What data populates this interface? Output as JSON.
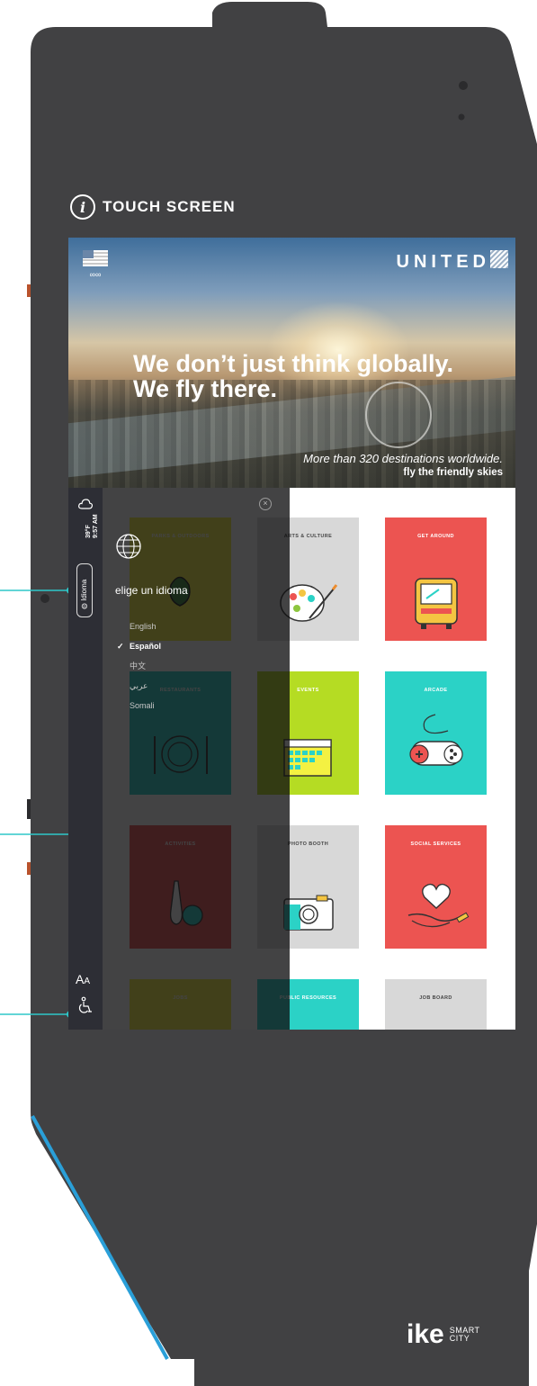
{
  "header": {
    "title": "TOUCH SCREEN",
    "info_icon": "info-icon"
  },
  "ad": {
    "brand": "UNITED",
    "headline_line1": "We don’t just think globally.",
    "headline_line2": "We fly there.",
    "tagline": "More than 320 destinations worldwide.",
    "sub_tagline": "fly the friendly skies"
  },
  "sidebar": {
    "temperature": "39°F",
    "time": "9:57 AM",
    "language_button": "Idioma",
    "text_size_label": "A",
    "text_size_label_small": "A"
  },
  "overlay": {
    "title": "elige un idioma",
    "languages": [
      {
        "label": "English",
        "selected": false
      },
      {
        "label": "Español",
        "selected": true
      },
      {
        "label": "中文",
        "selected": false
      },
      {
        "label": "عربي",
        "selected": false
      },
      {
        "label": "Somali",
        "selected": false
      }
    ],
    "check_mark": "✓",
    "close_icon": "close-icon"
  },
  "tiles": [
    {
      "label": "PARKS & OUTDOORS",
      "color": "#f4f142",
      "dimmed": true
    },
    {
      "label": "ARTS & CULTURE",
      "color": "#d8d8d8",
      "dimmed": true,
      "light": true
    },
    {
      "label": "GET AROUND",
      "color": "#ec5451",
      "dimmed": false
    },
    {
      "label": "RESTAURANTS",
      "color": "#2bd2c6",
      "dimmed": true
    },
    {
      "label": "EVENTS",
      "color": "#b5dc23",
      "dimmed": true
    },
    {
      "label": "ARCADE",
      "color": "#2bd2c6",
      "dimmed": false
    },
    {
      "label": "ACTIVITIES",
      "color": "#ec5451",
      "dimmed": true
    },
    {
      "label": "PHOTO BOOTH",
      "color": "#d8d8d8",
      "dimmed": true,
      "light": true
    },
    {
      "label": "SOCIAL SERVICES",
      "color": "#ec5451",
      "dimmed": false
    },
    {
      "label": "JOBS",
      "color": "#f4f142",
      "dimmed": true
    },
    {
      "label": "PUBLIC RESOURCES",
      "color": "#2bd2c6",
      "dimmed": true
    },
    {
      "label": "JOB BOARD",
      "color": "#d8d8d8",
      "dimmed": false,
      "light": true
    }
  ],
  "footer": {
    "logo": "ike",
    "logo_sub1": "SMART",
    "logo_sub2": "CITY"
  },
  "colors": {
    "kiosk_body": "#414143",
    "callout": "#2ec7c9",
    "accent_blue": "#2a9fd8",
    "side_button": "#b8522c"
  }
}
